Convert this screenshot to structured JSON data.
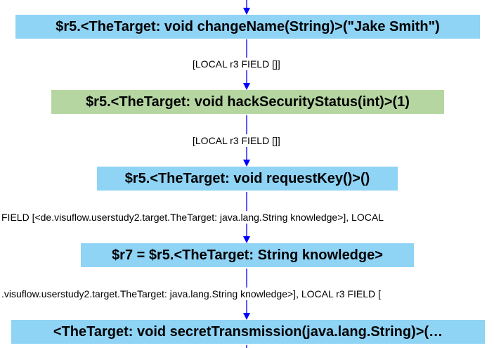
{
  "colors": {
    "method_node": "#8fd3f5",
    "highlighted_node": "#b5d6a1",
    "edge": "#0000ff"
  },
  "nodes": [
    {
      "text": "$r5.<TheTarget: void changeName(String)>(\"Jake Smith\")"
    },
    {
      "text": "$r5.<TheTarget: void hackSecurityStatus(int)>(1)"
    },
    {
      "text": "$r5.<TheTarget: void requestKey()>()"
    },
    {
      "text": "$r7 = $r5.<TheTarget: String knowledge>"
    },
    {
      "text": "<TheTarget: void secretTransmission(java.lang.String)>(…"
    }
  ],
  "edge_labels": [
    {
      "text": "[LOCAL r3 FIELD []]"
    },
    {
      "text": "[LOCAL r3 FIELD []]"
    },
    {
      "text": "FIELD [<de.visuflow.userstudy2.target.TheTarget: java.lang.String knowledge>], LOCAL"
    },
    {
      "text": ".visuflow.userstudy2.target.TheTarget: java.lang.String knowledge>], LOCAL r3 FIELD ["
    }
  ]
}
